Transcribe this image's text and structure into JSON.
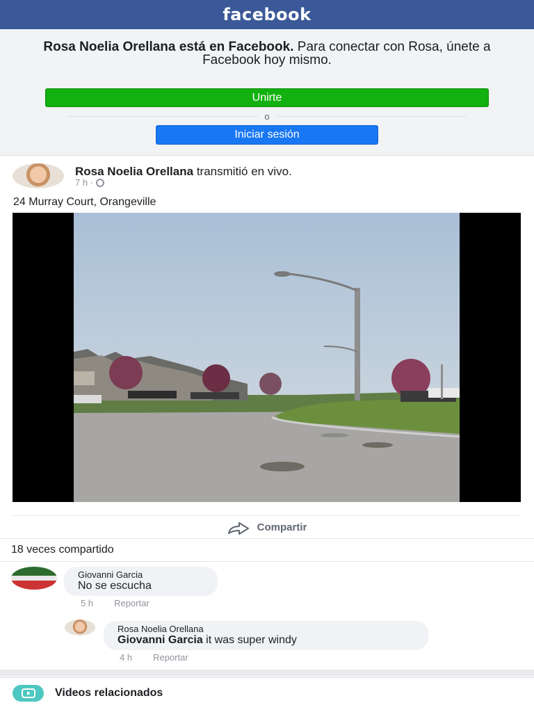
{
  "header": {
    "logo": "facebook"
  },
  "join_panel": {
    "name": "Rosa Noelia Orellana está en Facebook.",
    "message": "Para conectar con Rosa, únete a Facebook hoy mismo.",
    "join_label": "Unirte",
    "or_label": "o",
    "login_label": "Iniciar sesión"
  },
  "post": {
    "author": "Rosa Noelia Orellana",
    "action": "transmitió en vivo.",
    "time": "7 h ·",
    "text": "24 Murray Court, Orangeville",
    "share_label": "Compartir",
    "share_count": "18 veces compartido"
  },
  "comments": [
    {
      "author": "Giovanni Garcia",
      "text": "No se escucha",
      "time": "5 h",
      "report": "Reportar"
    },
    {
      "author": "Rosa Noelia Orellana",
      "mention": "Giovanni Garcia",
      "text": "it was super windy",
      "time": "4 h",
      "report": "Reportar"
    }
  ],
  "related": {
    "label": "Videos relacionados"
  },
  "colors": {
    "brand": "#3b5998",
    "join": "#12b10f",
    "login": "#1877f2",
    "related_icon": "#4ec7c2"
  }
}
